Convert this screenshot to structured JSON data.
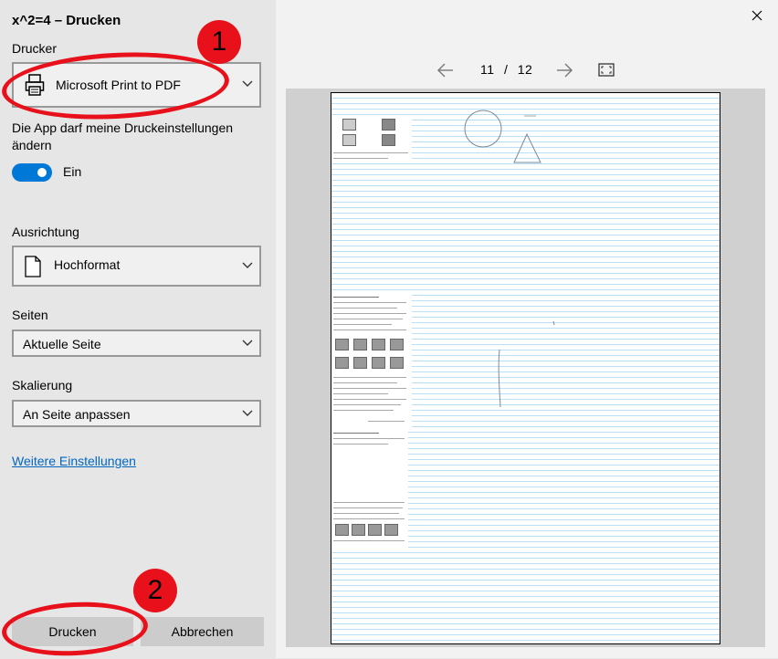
{
  "dialog": {
    "title": "x^2=4 – Drucken"
  },
  "printer": {
    "label": "Drucker",
    "value": "Microsoft Print to PDF",
    "icon": "printer-icon"
  },
  "app_settings": {
    "label": "Die App darf meine Druckeinstellungen ändern",
    "toggle_state": "Ein",
    "toggle_on": true
  },
  "orientation": {
    "label": "Ausrichtung",
    "value": "Hochformat",
    "icon": "page-portrait-icon"
  },
  "pages": {
    "label": "Seiten",
    "value": "Aktuelle Seite"
  },
  "scaling": {
    "label": "Skalierung",
    "value": "An Seite anpassen"
  },
  "more_settings": {
    "label": "Weitere Einstellungen"
  },
  "actions": {
    "print_label": "Drucken",
    "cancel_label": "Abbrechen"
  },
  "preview": {
    "current_page": "11",
    "separator": "/",
    "total_pages": "12"
  },
  "annotations": {
    "badge_1": "1",
    "badge_2": "2"
  },
  "colors": {
    "accent": "#0078d7",
    "annotation_red": "#e8111b",
    "link": "#0067c0"
  }
}
